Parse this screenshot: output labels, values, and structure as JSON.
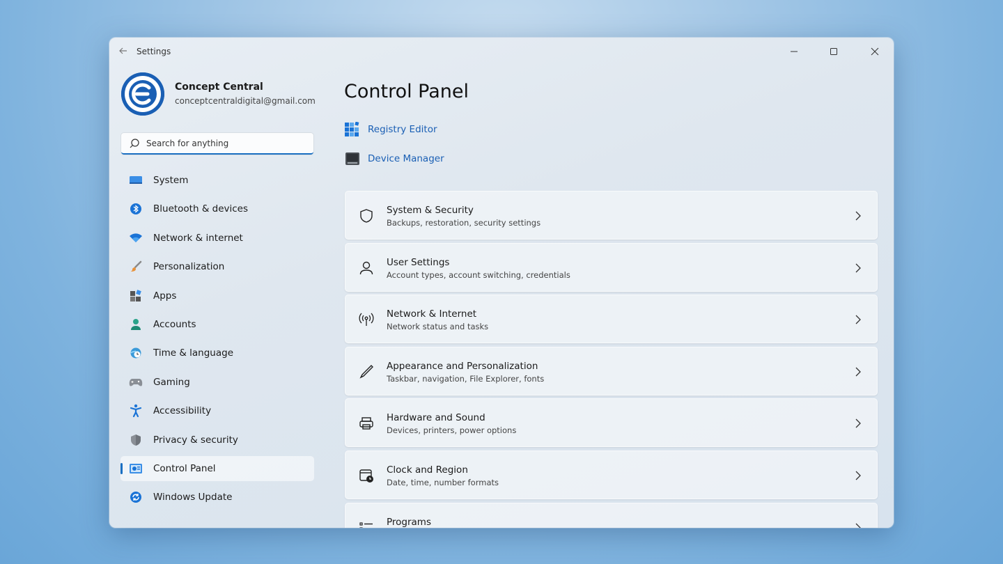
{
  "window": {
    "title": "Settings"
  },
  "profile": {
    "name": "Concept Central",
    "email": "conceptcentraldigital@gmail.com"
  },
  "search": {
    "placeholder": "Search for anything"
  },
  "sidebar": {
    "items": [
      {
        "label": "System",
        "icon": "monitor-icon"
      },
      {
        "label": "Bluetooth & devices",
        "icon": "bluetooth-icon"
      },
      {
        "label": "Network & internet",
        "icon": "wifi-icon"
      },
      {
        "label": "Personalization",
        "icon": "brush-icon"
      },
      {
        "label": "Apps",
        "icon": "apps-icon"
      },
      {
        "label": "Accounts",
        "icon": "person-icon"
      },
      {
        "label": "Time & language",
        "icon": "clock-globe-icon"
      },
      {
        "label": "Gaming",
        "icon": "gamepad-icon"
      },
      {
        "label": "Accessibility",
        "icon": "accessibility-icon"
      },
      {
        "label": "Privacy & security",
        "icon": "shield-icon"
      },
      {
        "label": "Control Panel",
        "icon": "control-panel-icon",
        "active": true
      },
      {
        "label": "Windows Update",
        "icon": "refresh-icon"
      }
    ]
  },
  "main": {
    "title": "Control Panel",
    "links": [
      {
        "label": "Registry Editor",
        "icon": "registry-icon"
      },
      {
        "label": "Device Manager",
        "icon": "device-manager-icon"
      }
    ],
    "cards": [
      {
        "title": "System & Security",
        "subtitle": "Backups, restoration, security settings",
        "icon": "shield-outline-icon"
      },
      {
        "title": "User Settings",
        "subtitle": "Account types, account switching, credentials",
        "icon": "user-outline-icon"
      },
      {
        "title": "Network & Internet",
        "subtitle": "Network status and tasks",
        "icon": "antenna-icon"
      },
      {
        "title": "Appearance and Personalization",
        "subtitle": "Taskbar, navigation, File Explorer, fonts",
        "icon": "pen-icon"
      },
      {
        "title": "Hardware and Sound",
        "subtitle": "Devices, printers, power options",
        "icon": "printer-icon"
      },
      {
        "title": "Clock and Region",
        "subtitle": "Date, time, number formats",
        "icon": "calendar-clock-icon"
      },
      {
        "title": "Programs",
        "subtitle": "",
        "icon": "list-icon"
      }
    ]
  },
  "colors": {
    "accent": "#1a6fc2",
    "link": "#1a5fb4"
  }
}
